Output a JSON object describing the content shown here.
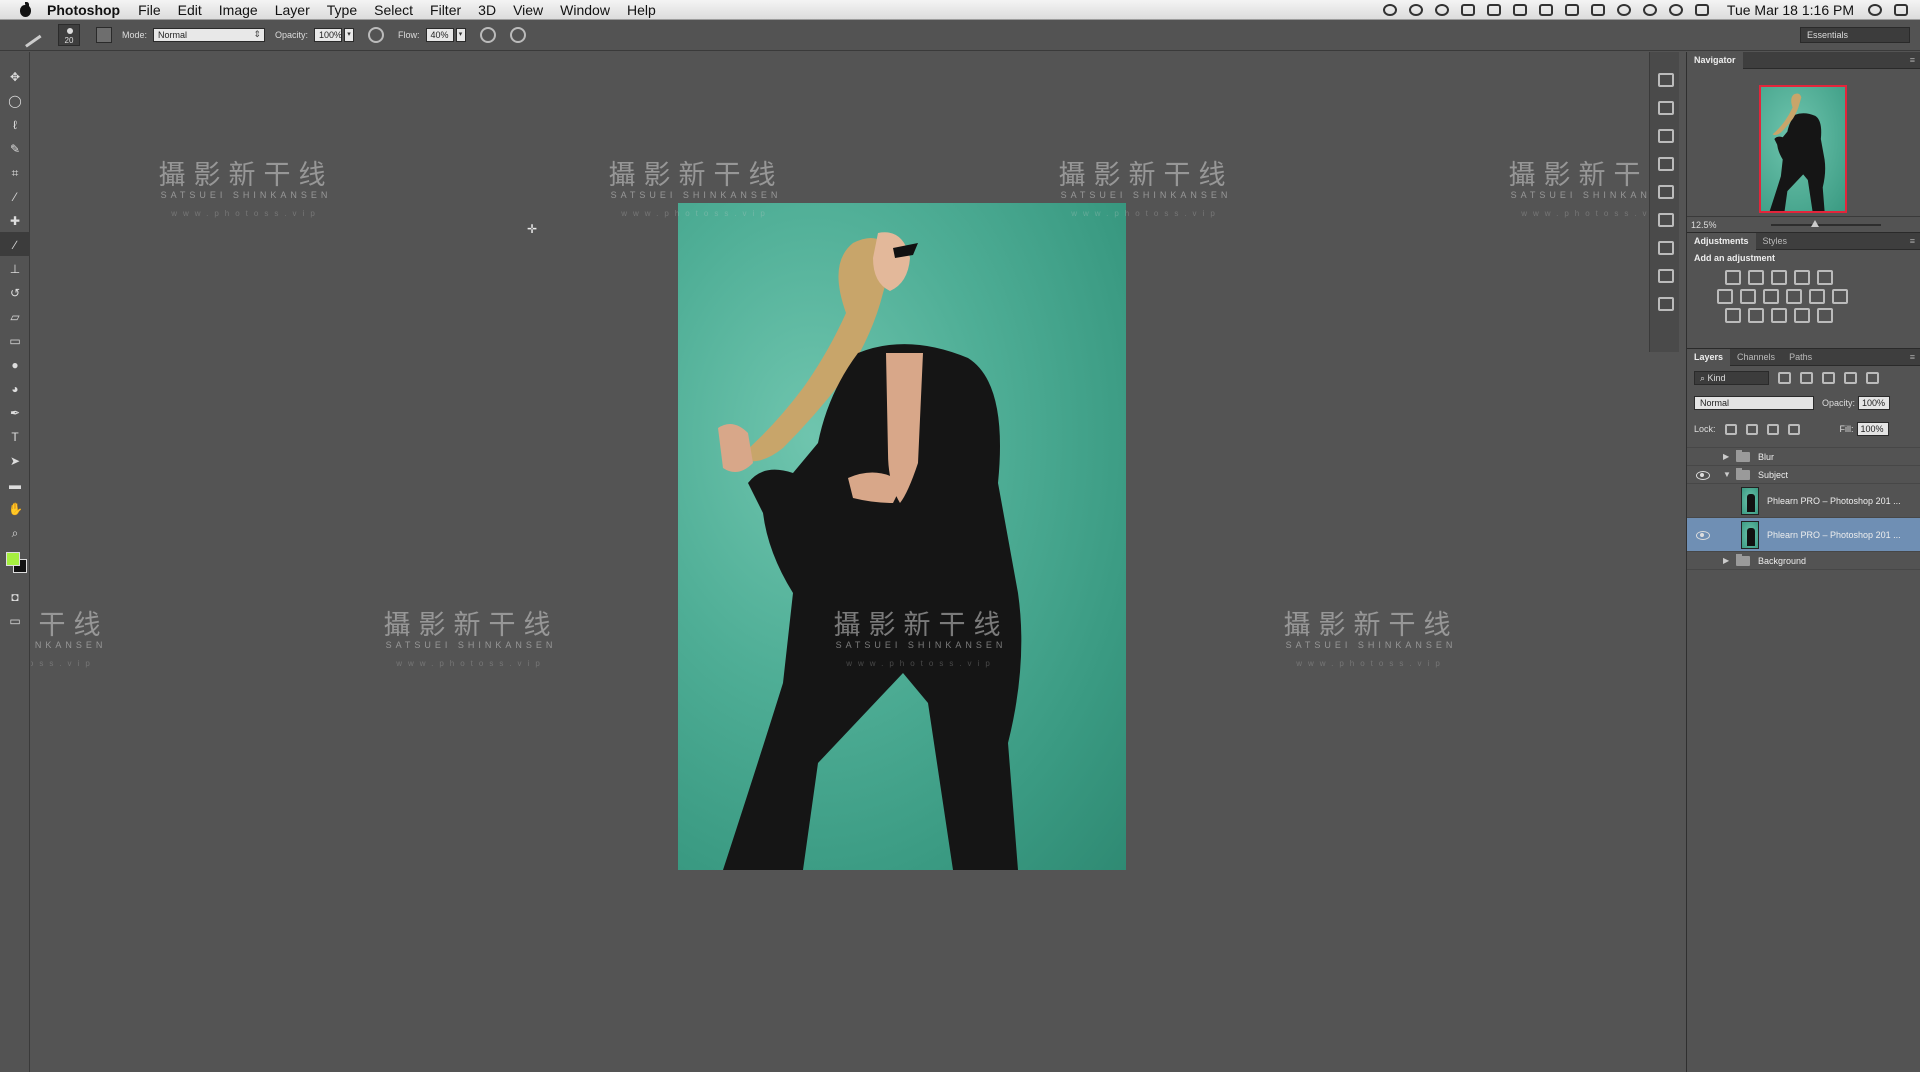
{
  "menubar": {
    "app_name": "Photoshop",
    "items": [
      "File",
      "Edit",
      "Image",
      "Layer",
      "Type",
      "Select",
      "Filter",
      "3D",
      "View",
      "Window",
      "Help"
    ],
    "clock": "Tue Mar 18  1:16 PM"
  },
  "options_bar": {
    "brush_size": "20",
    "mode_label": "Mode:",
    "mode_value": "Normal",
    "opacity_label": "Opacity:",
    "opacity_value": "100%",
    "flow_label": "Flow:",
    "flow_value": "40%",
    "workspace": "Essentials"
  },
  "toolbar": {
    "tools": [
      "move-tool",
      "elliptical-marquee-tool",
      "lasso-tool",
      "quick-selection-tool",
      "crop-tool",
      "eyedropper-tool",
      "spot-healing-tool",
      "brush-tool",
      "clone-stamp-tool",
      "history-brush-tool",
      "eraser-tool",
      "gradient-tool",
      "blur-tool",
      "dodge-tool",
      "pen-tool",
      "type-tool",
      "path-selection-tool",
      "rectangle-tool",
      "hand-tool",
      "zoom-tool"
    ],
    "active_tool": "brush-tool",
    "foreground_color": "#a6f040",
    "background_color": "#111111"
  },
  "watermark": {
    "cn": "攝影新干线",
    "en": "SATSUEI SHINKANSEN",
    "url": "www.photoss.vip"
  },
  "navigator": {
    "tab": "Navigator",
    "zoom": "12.5%"
  },
  "adjustments": {
    "tabs": [
      "Adjustments",
      "Styles"
    ],
    "add_label": "Add an adjustment"
  },
  "layers": {
    "tabs": [
      "Layers",
      "Channels",
      "Paths"
    ],
    "filter_kind": "Kind",
    "blend_mode": "Normal",
    "opacity_label": "Opacity:",
    "opacity_value": "100%",
    "lock_label": "Lock:",
    "fill_label": "Fill:",
    "fill_value": "100%",
    "items": [
      {
        "name": "Blur",
        "type": "group",
        "visible": false,
        "expanded": false
      },
      {
        "name": "Subject",
        "type": "group",
        "visible": true,
        "expanded": true
      },
      {
        "name": "Phlearn PRO – Photoshop 201 ...",
        "type": "layer",
        "visible": false,
        "selected": false
      },
      {
        "name": "Phlearn PRO – Photoshop 201 ...",
        "type": "layer",
        "visible": true,
        "selected": true
      },
      {
        "name": "Background",
        "type": "group",
        "visible": false,
        "expanded": false
      }
    ]
  },
  "colors": {
    "ui_bg": "#545454",
    "panel_bg": "#535353",
    "photo_bg": "#4fae96",
    "selection": "#6f8fb4",
    "nav_frame": "#e3253b"
  }
}
